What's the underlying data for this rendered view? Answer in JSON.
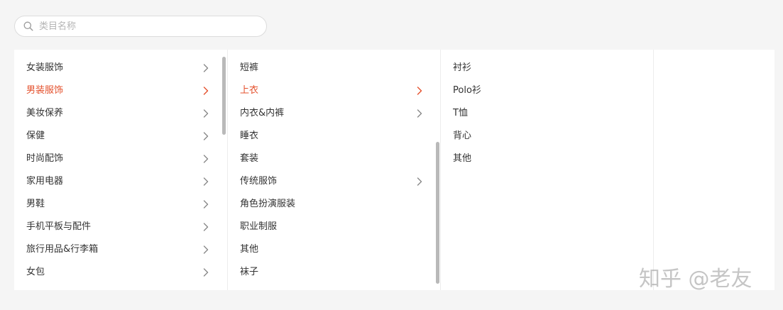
{
  "search": {
    "placeholder": "类目名称"
  },
  "columns": [
    {
      "items": [
        {
          "label": "女装服饰",
          "has_children": true,
          "active": false
        },
        {
          "label": "男装服饰",
          "has_children": true,
          "active": true
        },
        {
          "label": "美妆保养",
          "has_children": true,
          "active": false
        },
        {
          "label": "保健",
          "has_children": true,
          "active": false
        },
        {
          "label": "时尚配饰",
          "has_children": true,
          "active": false
        },
        {
          "label": "家用电器",
          "has_children": true,
          "active": false
        },
        {
          "label": "男鞋",
          "has_children": true,
          "active": false
        },
        {
          "label": "手机平板与配件",
          "has_children": true,
          "active": false
        },
        {
          "label": "旅行用品&行李箱",
          "has_children": true,
          "active": false
        },
        {
          "label": "女包",
          "has_children": true,
          "active": false
        }
      ]
    },
    {
      "items": [
        {
          "label": "短裤",
          "has_children": false,
          "active": false
        },
        {
          "label": "上衣",
          "has_children": true,
          "active": true
        },
        {
          "label": "内衣&内裤",
          "has_children": true,
          "active": false
        },
        {
          "label": "睡衣",
          "has_children": false,
          "active": false
        },
        {
          "label": "套装",
          "has_children": false,
          "active": false
        },
        {
          "label": "传统服饰",
          "has_children": true,
          "active": false
        },
        {
          "label": "角色扮演服装",
          "has_children": false,
          "active": false
        },
        {
          "label": "职业制服",
          "has_children": false,
          "active": false
        },
        {
          "label": "其他",
          "has_children": false,
          "active": false
        },
        {
          "label": "袜子",
          "has_children": false,
          "active": false
        }
      ]
    },
    {
      "items": [
        {
          "label": "衬衫",
          "has_children": false,
          "active": false
        },
        {
          "label": "Polo衫",
          "has_children": false,
          "active": false
        },
        {
          "label": "T恤",
          "has_children": false,
          "active": false
        },
        {
          "label": "背心",
          "has_children": false,
          "active": false
        },
        {
          "label": "其他",
          "has_children": false,
          "active": false
        }
      ]
    },
    {
      "items": []
    }
  ],
  "watermark": "知乎 @老友",
  "colors": {
    "accent": "#e4502c",
    "text": "#333333",
    "chevron": "#888888",
    "scrollbar": "#b9b9b9"
  },
  "icons": {
    "search": "search-icon",
    "chevron": "chevron-right-icon"
  }
}
